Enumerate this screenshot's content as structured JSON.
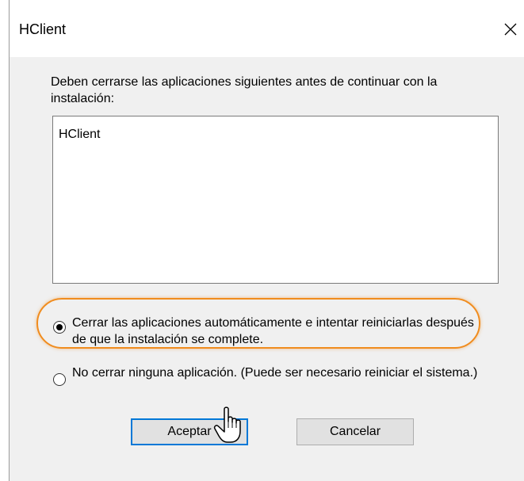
{
  "window": {
    "title": "HClient"
  },
  "message": "Deben cerrarse las aplicaciones siguientes antes de continuar con la instalación:",
  "apps": [
    "HClient"
  ],
  "options": [
    {
      "label": "Cerrar las aplicaciones automáticamente e intentar reiniciarlas después de que la instalación se complete.",
      "selected": true
    },
    {
      "label": "No cerrar ninguna aplicación. (Puede ser necesario reiniciar el sistema.)",
      "selected": false
    }
  ],
  "buttons": {
    "ok": "Aceptar",
    "cancel": "Cancelar"
  },
  "colors": {
    "highlight": "#f08c1e",
    "default_button_border": "#0078d7"
  },
  "icons": {
    "close": "close-icon",
    "cursor": "hand-pointer-icon"
  }
}
